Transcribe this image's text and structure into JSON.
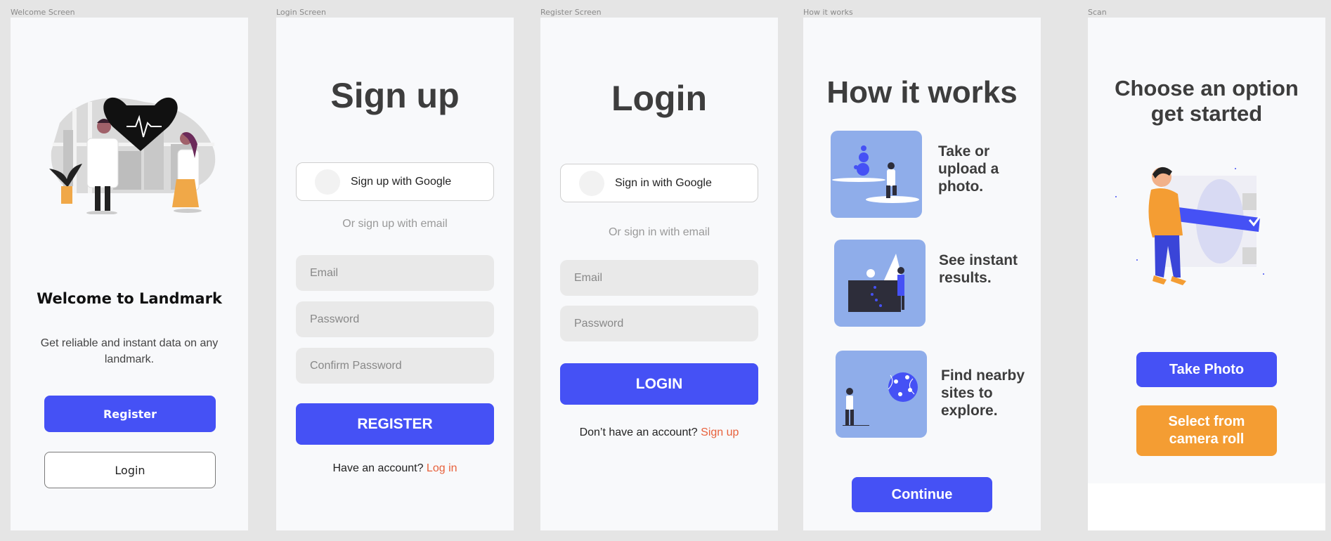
{
  "frames": {
    "welcome": {
      "label": "Welcome Screen",
      "title": "Welcome to Landmark",
      "description": "Get reliable and instant data on any landmark.",
      "register_label": "Register",
      "login_label": "Login"
    },
    "login_screen": {
      "label": "Login Screen",
      "title": "Sign up",
      "google_label": "Sign up with Google",
      "divider_text": "Or sign up with email",
      "email_placeholder": "Email",
      "password_placeholder": "Password",
      "confirm_placeholder": "Confirm Password",
      "register_label": "REGISTER",
      "footer_text": "Have an account?",
      "footer_link": "Log in"
    },
    "register_screen": {
      "label": "Register Screen",
      "title": "Login",
      "google_label": "Sign in with Google",
      "divider_text": "Or sign in with email",
      "email_placeholder": "Email",
      "password_placeholder": "Password",
      "login_label": "LOGIN",
      "footer_text": "Don’t have an account?",
      "footer_link": "Sign up"
    },
    "how": {
      "label": "How it works",
      "title": "How it works",
      "steps": [
        {
          "text": "Take or upload a photo."
        },
        {
          "text": "See instant results."
        },
        {
          "text": "Find nearby sites to explore."
        }
      ],
      "continue_label": "Continue"
    },
    "scan": {
      "label": "Scan",
      "title_line1": "Choose an option",
      "title_line2": "get started",
      "take_photo_label": "Take Photo",
      "camera_roll_label": "Select from camera roll"
    }
  },
  "colors": {
    "accent": "#4551f5",
    "orange": "#f49d33",
    "link": "#e8613c",
    "illustration_blue": "#8fadea"
  }
}
